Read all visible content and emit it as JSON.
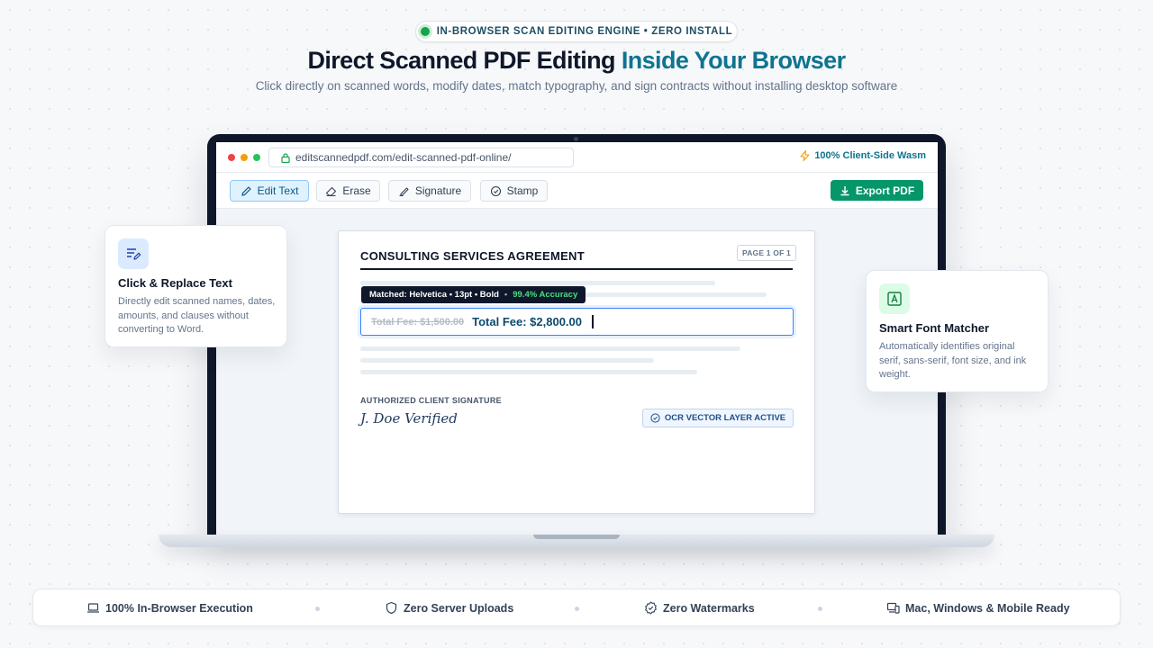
{
  "badge": {
    "text": "IN-BROWSER SCAN EDITING ENGINE • ZERO INSTALL"
  },
  "hero": {
    "title_main": "Direct Scanned PDF Editing",
    "title_accent": "Inside Your Browser",
    "subtitle": "Click directly on scanned words, modify dates, match typography, and sign contracts without installing desktop software"
  },
  "browser": {
    "url": "editscannedpdf.com/edit-scanned-pdf-online/",
    "wasm_badge": "100% Client-Side Wasm"
  },
  "toolbar": {
    "tools": [
      "Edit Text",
      "Erase",
      "Signature",
      "Stamp"
    ],
    "active_tool": "Edit Text",
    "export_label": "Export PDF"
  },
  "document": {
    "title": "CONSULTING SERVICES AGREEMENT",
    "page_label": "PAGE 1 OF 1",
    "tooltip_match": "Matched: Helvetica • 13pt • Bold",
    "tooltip_sep": "•",
    "tooltip_accuracy": "99.4% Accuracy",
    "old_value": "Total Fee: $1,500.00",
    "new_value": "Total Fee: $2,800.00",
    "signature_label": "AUTHORIZED CLIENT SIGNATURE",
    "signature_value": "J. Doe Verified",
    "ocr_badge": "OCR VECTOR LAYER ACTIVE"
  },
  "cards": {
    "left": {
      "icon": "text-edit-icon",
      "title": "Click & Replace Text",
      "description": "Directly edit scanned names, dates, amounts, and clauses without converting to Word."
    },
    "right": {
      "icon": "font-match-icon",
      "title": "Smart Font Matcher",
      "description": "Automatically identifies original serif, sans-serif, font size, and ink weight."
    }
  },
  "features": [
    {
      "icon": "laptop-icon",
      "label": "100% In-Browser Execution"
    },
    {
      "icon": "shield-icon",
      "label": "Zero Server Uploads"
    },
    {
      "icon": "verified-badge-icon",
      "label": "Zero Watermarks"
    },
    {
      "icon": "devices-icon",
      "label": "Mac, Windows & Mobile Ready"
    }
  ],
  "colors": {
    "accent": "#0e7490",
    "export_green": "#059669",
    "status_green": "#16a34a",
    "edit_blue": "#3b82f6"
  }
}
